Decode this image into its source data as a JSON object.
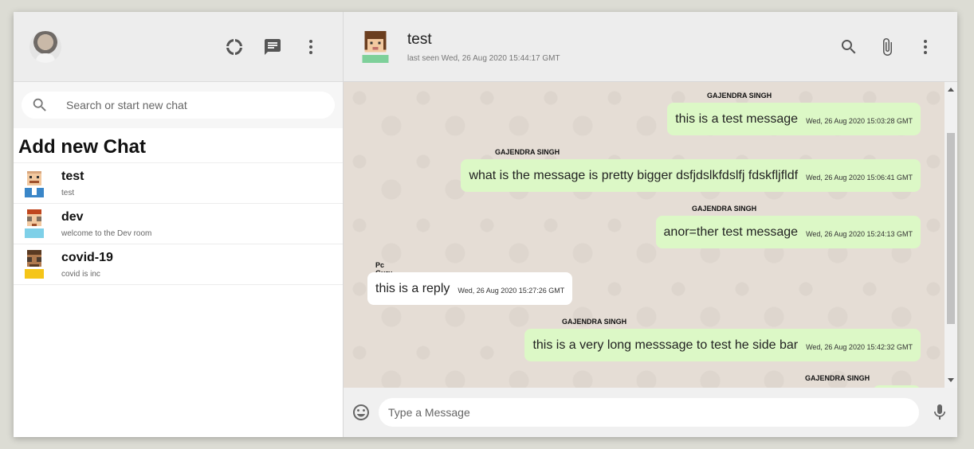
{
  "sidebar": {
    "search_placeholder": "Search or start new chat",
    "add_new_chat": "Add new Chat",
    "rooms": [
      {
        "name": "test",
        "last": "test"
      },
      {
        "name": "dev",
        "last": "welcome to the Dev room"
      },
      {
        "name": "covid-19",
        "last": "covid is inc"
      }
    ]
  },
  "chat": {
    "title": "test",
    "last_seen": "last seen Wed, 26 Aug 2020 15:44:17 GMT",
    "messages": [
      {
        "sender": "GAJENDRA SINGH",
        "text": "this is a test message",
        "time": "Wed, 26 Aug 2020 15:03:28 GMT",
        "sent": true
      },
      {
        "sender": "GAJENDRA SINGH",
        "text": "what is the message is pretty bigger dsfjdslkfdslfj fdskfljfldf",
        "time": "Wed, 26 Aug 2020 15:06:41 GMT",
        "sent": true
      },
      {
        "sender": "GAJENDRA SINGH",
        "text": "anor=ther test message",
        "time": "Wed, 26 Aug 2020 15:24:13 GMT",
        "sent": true
      },
      {
        "sender": "Pc Guru",
        "text": "this is a reply",
        "time": "Wed, 26 Aug 2020 15:27:26 GMT",
        "sent": false
      },
      {
        "sender": "GAJENDRA SINGH",
        "text": "this is a very long messsage to test he side bar",
        "time": "Wed, 26 Aug 2020 15:42:32 GMT",
        "sent": true
      },
      {
        "sender": "GAJENDRA SINGH",
        "text": "",
        "time": "",
        "sent": true
      }
    ],
    "input_placeholder": "Type a Message"
  },
  "colors": {
    "sent_bubble": "#dcf8c6",
    "received_bubble": "#ffffff",
    "header_bg": "#ededed",
    "chat_bg": "#e5ddd5"
  },
  "icons": {
    "status": "status-icon",
    "new_chat": "message-icon",
    "menu": "more-vert-icon",
    "search": "search-icon",
    "attach": "attach-icon",
    "emoji": "emoji-icon",
    "mic": "mic-icon"
  }
}
